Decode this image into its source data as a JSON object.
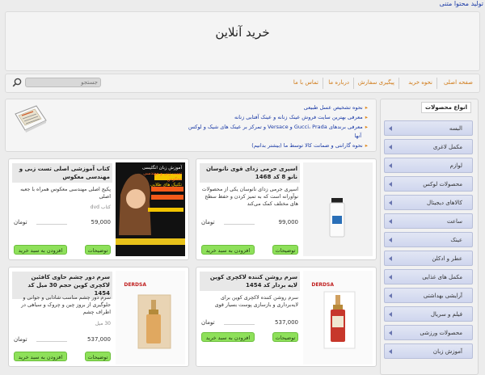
{
  "topbar": {
    "link": "تولید محتوا متنی"
  },
  "header": {
    "title": "خرید آنلاین"
  },
  "nav": {
    "items": [
      "صفحه اصلی",
      "نحوه خرید",
      "پیگیری سفارش",
      "درباره ما",
      "تماس با ما"
    ],
    "search_placeholder": "جستجو"
  },
  "sidebar": {
    "title": "انواع محصولات",
    "categories": [
      "البسه",
      "مکمل لاغری",
      "لوازم",
      "محصولات لوکس",
      "کالاهای دیجیتال",
      "ساعت",
      "عینک",
      "عطر و ادکلن",
      "مکمل های غذایی",
      "آرایشی بهداشتی",
      "فیلم و سریال",
      "محصولات ورزشی",
      "آموزش زبان"
    ]
  },
  "news": {
    "items": [
      "نحوه تشخیص عسل طبیعی",
      "معرفی بهترین سایت فروش عینک زنانه و عینک آفتابی زنانه",
      "معرفی برندهای Gucci، Prada و Versace و تمرکز بر عینک های شیک و لوکس",
      "آنها",
      "نحوه گارانتی و ضمانت کالا توسط ما (بیشتر بدانیم)"
    ]
  },
  "products": [
    {
      "title": "اسپری جرمی زدای قوی نانوسان نانو 8 کد 1468",
      "desc": "اسپری جرمی زدای نانوسان یکی از محصولات نوآورانه است که به تمیز کردن و حفظ سطح های مختلف کمک می‌کند",
      "meta": "",
      "price": "99,000",
      "currency": "تومان",
      "btn_desc": "توضیحات",
      "btn_add": "افزودن به سبد خرید"
    },
    {
      "title": "کتاب آموزشی اصلی تست زبی و مهندسی معکوس",
      "desc": "پکیج اصلی مهندسی معکوس همراه با جعبه اصلی",
      "meta": "کتاب dvd",
      "price": "59,000",
      "currency": "تومان",
      "btn_desc": "توضیحات",
      "btn_add": "افزودن به سبد خرید",
      "image_text": [
        "آموزش زبان انگلیسی",
        "تست زنی و مهندسی معکوس",
        "تکنیک های طلایی"
      ]
    },
    {
      "title": "سرم روشن کننده لاکچری کوین لایه بردار کد 1454",
      "desc": "سرم روشن کننده لاکچری کوین برای لایه‌برداری و بازسازی پوست بسیار قوی",
      "meta": "",
      "price": "537,000",
      "currency": "تومان",
      "btn_desc": "توضیحات",
      "btn_add": "افزودن به سبد خرید",
      "brand": "DERDSA"
    },
    {
      "title": "سرم دور چشم حاوی کافئین لاکچری کوین حجم 30 میل کد 1454",
      "desc": "سرم دور چشم مناسب شادابی و جوانی و جلوگیری از بروز چین و چروک و سیاهی در اطراف چشم",
      "meta": "30 میل",
      "price": "537,000",
      "currency": "تومان",
      "btn_desc": "توضیحات",
      "btn_add": "افزودن به سبد خرید",
      "brand": "DERDSA"
    }
  ]
}
